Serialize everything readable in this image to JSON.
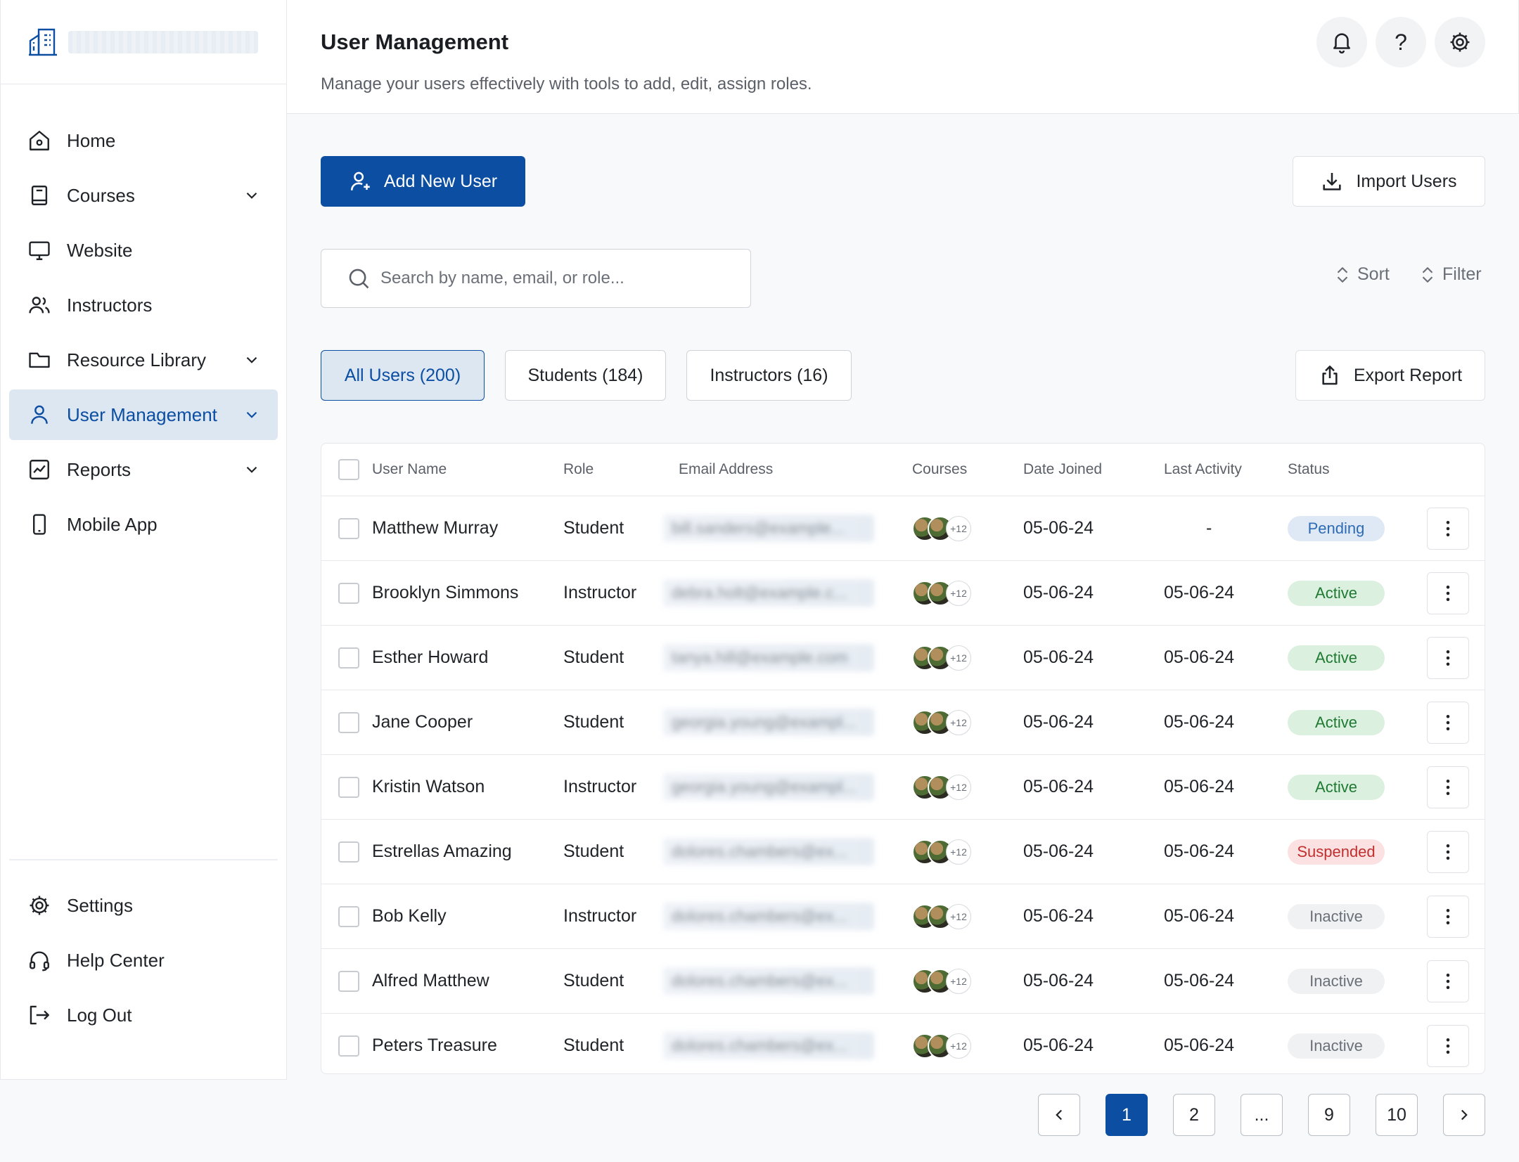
{
  "sidebar": {
    "nav": [
      {
        "label": "Home",
        "icon": "home-icon"
      },
      {
        "label": "Courses",
        "icon": "book-icon",
        "expandable": true
      },
      {
        "label": "Website",
        "icon": "monitor-icon"
      },
      {
        "label": "Instructors",
        "icon": "users-icon"
      },
      {
        "label": "Resource Library",
        "icon": "folder-icon",
        "expandable": true
      },
      {
        "label": "User Management",
        "icon": "user-icon",
        "expandable": true,
        "active": true
      },
      {
        "label": "Reports",
        "icon": "chart-icon",
        "expandable": true
      },
      {
        "label": "Mobile App",
        "icon": "mobile-icon"
      }
    ],
    "bottom": [
      {
        "label": "Settings",
        "icon": "gear-icon"
      },
      {
        "label": "Help Center",
        "icon": "headset-icon"
      },
      {
        "label": "Log Out",
        "icon": "logout-icon"
      }
    ]
  },
  "header": {
    "title": "User Management",
    "subtitle": "Manage your users effectively with tools to add, edit, assign roles.",
    "help_glyph": "?"
  },
  "actions": {
    "add_user": "Add New User",
    "import_users": "Import Users",
    "export_report": "Export Report",
    "sort": "Sort",
    "filter": "Filter"
  },
  "search": {
    "placeholder": "Search by name, email, or role...",
    "value": ""
  },
  "tabs": [
    {
      "label": "All Users (200)",
      "active": true
    },
    {
      "label": "Students (184)",
      "active": false
    },
    {
      "label": "Instructors (16)",
      "active": false
    }
  ],
  "table": {
    "columns": [
      "User Name",
      "Role",
      "Email Address",
      "Courses",
      "Date Joined",
      "Last Activity",
      "Status"
    ],
    "rows": [
      {
        "name": "Matthew Murray",
        "role": "Student",
        "email": "bill.sanders@example...",
        "courses_more": "+12",
        "joined": "05-06-24",
        "last": "-",
        "status": "Pending",
        "status_class": "pending"
      },
      {
        "name": "Brooklyn Simmons",
        "role": "Instructor",
        "email": "debra.holt@example.c...",
        "courses_more": "+12",
        "joined": "05-06-24",
        "last": "05-06-24",
        "status": "Active",
        "status_class": "active"
      },
      {
        "name": "Esther Howard",
        "role": "Student",
        "email": "tanya.hill@example.com",
        "courses_more": "+12",
        "joined": "05-06-24",
        "last": "05-06-24",
        "status": "Active",
        "status_class": "active"
      },
      {
        "name": "Jane Cooper",
        "role": "Student",
        "email": "georgia.young@exampl...",
        "courses_more": "+12",
        "joined": "05-06-24",
        "last": "05-06-24",
        "status": "Active",
        "status_class": "active"
      },
      {
        "name": "Kristin Watson",
        "role": "Instructor",
        "email": "georgia.young@exampl...",
        "courses_more": "+12",
        "joined": "05-06-24",
        "last": "05-06-24",
        "status": "Active",
        "status_class": "active"
      },
      {
        "name": "Estrellas Amazing",
        "role": "Student",
        "email": "dolores.chambers@ex...",
        "courses_more": "+12",
        "joined": "05-06-24",
        "last": "05-06-24",
        "status": "Suspended",
        "status_class": "suspended"
      },
      {
        "name": "Bob Kelly",
        "role": "Instructor",
        "email": "dolores.chambers@ex...",
        "courses_more": "+12",
        "joined": "05-06-24",
        "last": "05-06-24",
        "status": "Inactive",
        "status_class": "inactive"
      },
      {
        "name": "Alfred Matthew",
        "role": "Student",
        "email": "dolores.chambers@ex...",
        "courses_more": "+12",
        "joined": "05-06-24",
        "last": "05-06-24",
        "status": "Inactive",
        "status_class": "inactive"
      },
      {
        "name": "Peters Treasure",
        "role": "Student",
        "email": "dolores.chambers@ex...",
        "courses_more": "+12",
        "joined": "05-06-24",
        "last": "05-06-24",
        "status": "Inactive",
        "status_class": "inactive"
      }
    ]
  },
  "pagination": {
    "pages": [
      "1",
      "2",
      "...",
      "9",
      "10"
    ],
    "current": "1"
  },
  "colors": {
    "accent": "#0b4ea2",
    "active_nav_bg": "#dde7f2",
    "status_pending": "#2e6bb5",
    "status_active": "#1e7a32",
    "status_suspended": "#c0302f",
    "status_inactive": "#6b7078"
  }
}
